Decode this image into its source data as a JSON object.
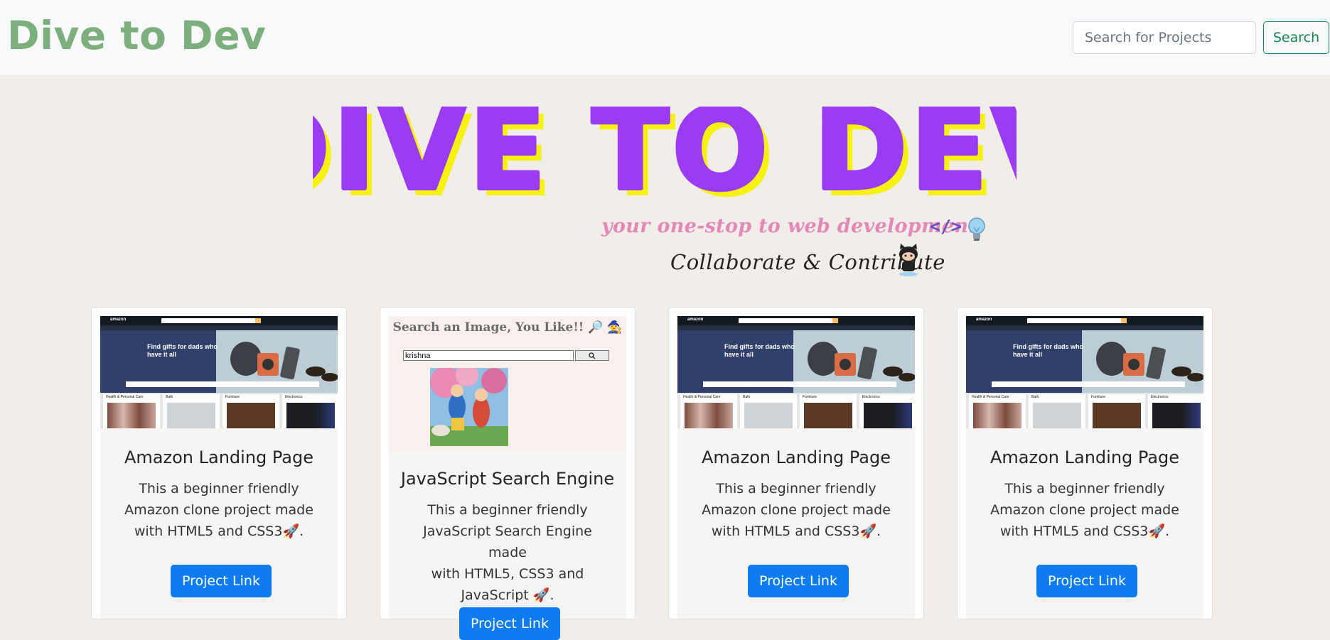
{
  "navbar": {
    "brand": "Dive to Dev",
    "search_placeholder": "Search for Projects",
    "search_button": "Search"
  },
  "hero": {
    "logo_text": "DIVE TO DEV",
    "tagline": "your one-stop to web development",
    "code_symbol": "</>",
    "collab_text": "Collaborate & Contribute"
  },
  "cards": [
    {
      "title": "Amazon Landing Page",
      "lines": [
        "This a beginner friendly",
        "Amazon clone project made",
        "with HTML5 and CSS3🚀."
      ],
      "button": "Project Link",
      "thumb": {
        "logo": "amazon",
        "hero_text": "Find gifts for dads who have it all",
        "tiles": [
          "Health & Personal Care",
          "Bath",
          "Furniture",
          "Electronics"
        ]
      }
    },
    {
      "title": "JavaScript Search Engine",
      "lines": [
        "This a beginner friendly",
        "JavaScript Search Engine made",
        "with HTML5, CSS3 and",
        "JavaScript 🚀."
      ],
      "button": "Project Link",
      "thumb": {
        "heading": "Search an Image, You Like!! 🔎 🧙",
        "input_value": "krishna"
      }
    },
    {
      "title": "Amazon Landing Page",
      "lines": [
        "This a beginner friendly",
        "Amazon clone project made",
        "with HTML5 and CSS3🚀."
      ],
      "button": "Project Link",
      "thumb": {
        "logo": "amazon",
        "hero_text": "Find gifts for dads who have it all",
        "tiles": [
          "Health & Personal Care",
          "Bath",
          "Furniture",
          "Electronics"
        ]
      }
    },
    {
      "title": "Amazon Landing Page",
      "lines": [
        "This a beginner friendly",
        "Amazon clone project made",
        "with HTML5 and CSS3🚀."
      ],
      "button": "Project Link",
      "thumb": {
        "logo": "amazon",
        "hero_text": "Find gifts for dads who have it all",
        "tiles": [
          "Health & Personal Care",
          "Bath",
          "Furniture",
          "Electronics"
        ]
      }
    }
  ],
  "colors": {
    "brand": "#7dae7d",
    "logo_fill": "#9b3cf5",
    "logo_shadow": "#f7f10f",
    "button": "#0d7cf2",
    "tagline": "#e489b7"
  },
  "icons": [
    "code-icon",
    "lightbulb-icon",
    "octocat-icon",
    "rocket-icon"
  ]
}
